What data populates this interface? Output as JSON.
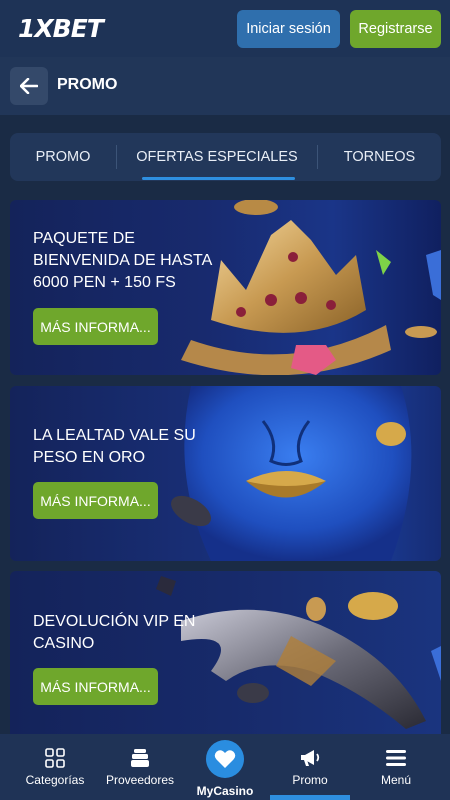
{
  "header": {
    "logo": "1XBET",
    "login_label": "Iniciar sesión",
    "register_label": "Registrarse"
  },
  "subheader": {
    "title": "PROMO"
  },
  "tabs": [
    {
      "label": "PROMO"
    },
    {
      "label": "OFERTAS ESPECIALES",
      "active": true
    },
    {
      "label": "TORNEOS"
    }
  ],
  "cards": [
    {
      "title": "PAQUETE DE BIENVENIDA DE HASTA 6000 PEN + 150 FS",
      "button": "MÁS INFORMA...",
      "art": "crown-illustration"
    },
    {
      "title": "LA LEALTAD VALE SU PESO EN ORO",
      "button": "MÁS INFORMA...",
      "art": "golden-lips-face-illustration"
    },
    {
      "title": "DEVOLUCIÓN VIP EN CASINO",
      "button": "MÁS INFORMA...",
      "art": "golden-horn-illustration"
    }
  ],
  "bottom_nav": [
    {
      "label": "Categorías",
      "icon": "grid-icon"
    },
    {
      "label": "Proveedores",
      "icon": "stack-icon"
    },
    {
      "label": "MyCasino",
      "icon": "heart-icon"
    },
    {
      "label": "Promo",
      "icon": "megaphone-icon",
      "active": true
    },
    {
      "label": "Menú",
      "icon": "hamburger-icon"
    }
  ],
  "colors": {
    "accent_green": "#6fa72c",
    "accent_blue": "#2e8fe0",
    "background": "#1a2b45"
  }
}
